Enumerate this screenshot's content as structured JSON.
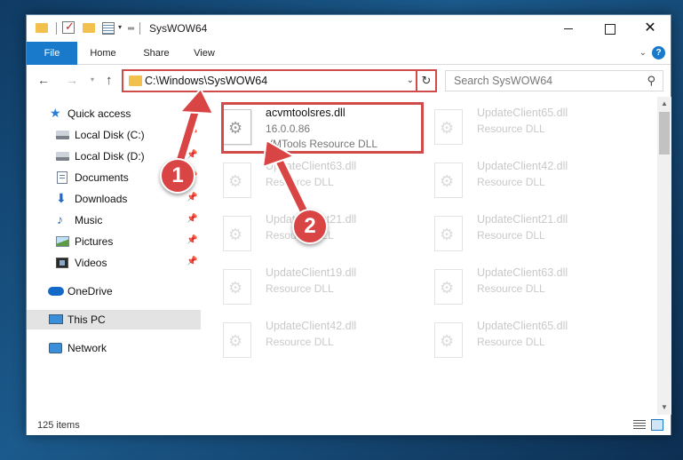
{
  "window": {
    "title": "SysWOW64",
    "controls": {
      "minimize": "",
      "maximize": "",
      "close": "✕"
    }
  },
  "ribbon": {
    "tabs": [
      "File",
      "Home",
      "Share",
      "View"
    ],
    "accent_color": "#1979ca"
  },
  "navigation": {
    "address": "C:\\Windows\\SysWOW64",
    "search_placeholder": "Search SysWOW64"
  },
  "sidebar": {
    "items": [
      {
        "label": "Quick access",
        "icon": "star-icon",
        "pinned": false
      },
      {
        "label": "Local Disk (C:)",
        "icon": "disk-icon",
        "pinned": true
      },
      {
        "label": "Local Disk (D:)",
        "icon": "disk-icon",
        "pinned": true
      },
      {
        "label": "Documents",
        "icon": "documents-icon",
        "pinned": true
      },
      {
        "label": "Downloads",
        "icon": "download-icon",
        "pinned": true
      },
      {
        "label": "Music",
        "icon": "music-icon",
        "pinned": true
      },
      {
        "label": "Pictures",
        "icon": "pictures-icon",
        "pinned": true
      },
      {
        "label": "Videos",
        "icon": "videos-icon",
        "pinned": true
      },
      {
        "label": "OneDrive",
        "icon": "cloud-icon",
        "pinned": false
      },
      {
        "label": "This PC",
        "icon": "pc-icon",
        "selected": true
      },
      {
        "label": "Network",
        "icon": "network-icon",
        "pinned": false
      }
    ]
  },
  "files": [
    {
      "name": "acvmtoolsres.dll",
      "version": "16.0.0.86",
      "description": "VMTools Resource DLL",
      "highlighted": true
    },
    {
      "name": "UpdateClient65.dll",
      "description": "Resource DLL",
      "faded": true
    },
    {
      "name": "UpdateClient63.dll",
      "description": "Resource DLL",
      "faded": true
    },
    {
      "name": "UpdateClient42.dll",
      "description": "Resource DLL",
      "faded": true
    },
    {
      "name": "UpdateClient21.dll",
      "description": "Resource DLL",
      "faded": true
    },
    {
      "name": "UpdateClient21.dll",
      "description": "Resource DLL",
      "faded": true
    },
    {
      "name": "UpdateClient19.dll",
      "description": "Resource DLL",
      "faded": true
    },
    {
      "name": "UpdateClient63.dll",
      "description": "Resource DLL",
      "faded": true
    },
    {
      "name": "UpdateClient42.dll",
      "description": "Resource DLL",
      "faded": true
    },
    {
      "name": "UpdateClient65.dll",
      "description": "Resource DLL",
      "faded": true
    }
  ],
  "status": {
    "item_count": "125 items"
  },
  "annotations": {
    "step1": "1",
    "step2": "2",
    "color": "#d94545"
  }
}
